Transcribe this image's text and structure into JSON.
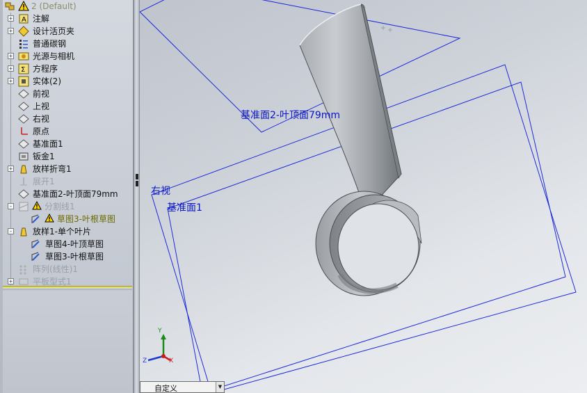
{
  "tree": {
    "root_label": "2  (Default)",
    "items": [
      {
        "label": "注解",
        "icon": "annotation-icon",
        "expander": "+",
        "dim": false
      },
      {
        "label": "设计活页夹",
        "icon": "design-binder-icon",
        "expander": "+",
        "dim": false
      },
      {
        "label": "普通碳钢",
        "icon": "material-icon",
        "expander": "",
        "dim": false
      },
      {
        "label": "光源与相机",
        "icon": "lights-cameras-icon",
        "expander": "+",
        "dim": false
      },
      {
        "label": "方程序",
        "icon": "equations-icon",
        "expander": "+",
        "dim": false
      },
      {
        "label": "实体(2)",
        "icon": "solid-bodies-icon",
        "expander": "+",
        "dim": false
      },
      {
        "label": "前视",
        "icon": "plane-icon",
        "expander": "",
        "dim": false
      },
      {
        "label": "上视",
        "icon": "plane-icon",
        "expander": "",
        "dim": false
      },
      {
        "label": "右视",
        "icon": "plane-icon",
        "expander": "",
        "dim": false
      },
      {
        "label": "原点",
        "icon": "origin-icon",
        "expander": "",
        "dim": false
      },
      {
        "label": "基准面1",
        "icon": "plane-icon",
        "expander": "",
        "dim": false
      },
      {
        "label": "钣金1",
        "icon": "sheet-metal-icon",
        "expander": "",
        "dim": false
      },
      {
        "label": "放样折弯1",
        "icon": "lofted-bend-icon",
        "expander": "+",
        "dim": false
      },
      {
        "label": "展开1",
        "icon": "unfold-icon",
        "expander": "",
        "dim": true
      },
      {
        "label": "基准面2-叶顶面79mm",
        "icon": "plane-icon",
        "expander": "",
        "dim": false
      },
      {
        "label": "分割线1",
        "icon": "split-line-icon",
        "expander": "-",
        "dim": true
      },
      {
        "label": "草图3-叶根草图",
        "icon": "sketch-icon",
        "expander": "",
        "dim": false,
        "warn": true
      },
      {
        "label": "放样1-单个叶片",
        "icon": "loft-icon",
        "expander": "-",
        "dim": false
      },
      {
        "label": "草图4-叶顶草图",
        "icon": "sketch-icon",
        "expander": "",
        "dim": false
      },
      {
        "label": "草图3-叶根草图",
        "icon": "sketch-icon",
        "expander": "",
        "dim": false
      },
      {
        "label": "阵列(线性)1",
        "icon": "linear-pattern-icon",
        "expander": "",
        "dim": true
      },
      {
        "label": "平板型式1",
        "icon": "flat-pattern-icon",
        "expander": "+",
        "dim": true
      }
    ]
  },
  "viewport": {
    "plane_labels": {
      "plane2": "基准面2-叶顶面79mm",
      "right": "右视",
      "plane1": "基准面1"
    },
    "triad": {
      "x": "X",
      "y": "Y",
      "z": "Z"
    },
    "plane_color": "#0a14c8"
  },
  "view_dropdown": {
    "value": "自定义"
  }
}
